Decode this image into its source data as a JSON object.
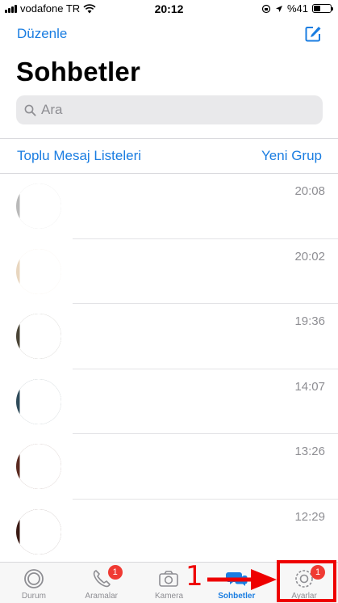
{
  "status_bar": {
    "carrier": "vodafone TR",
    "time": "20:12",
    "battery": "%41",
    "battery_level": 0.41
  },
  "header": {
    "edit_label": "Düzenle",
    "compose_icon": "compose-icon",
    "title": "Sohbetler"
  },
  "search": {
    "placeholder": "Ara"
  },
  "links": {
    "broadcast_lists": "Toplu Mesaj Listeleri",
    "new_group": "Yeni Grup"
  },
  "chats": [
    {
      "time": "20:08"
    },
    {
      "time": "20:02"
    },
    {
      "time": "19:36"
    },
    {
      "time": "14:07"
    },
    {
      "time": "13:26"
    },
    {
      "time": "12:29"
    }
  ],
  "tabs": [
    {
      "label": "Durum",
      "icon": "status-icon",
      "badge": ""
    },
    {
      "label": "Aramalar",
      "icon": "phone-icon",
      "badge": "1"
    },
    {
      "label": "Kamera",
      "icon": "camera-icon",
      "badge": ""
    },
    {
      "label": "Sohbetler",
      "icon": "chats-icon",
      "badge": ""
    },
    {
      "label": "Ayarlar",
      "icon": "gear-icon",
      "badge": "1"
    }
  ],
  "annotation": {
    "step_number": "1",
    "color": "#ee0000"
  },
  "colors": {
    "accent": "#1a7de1",
    "badge": "#f03a33"
  }
}
